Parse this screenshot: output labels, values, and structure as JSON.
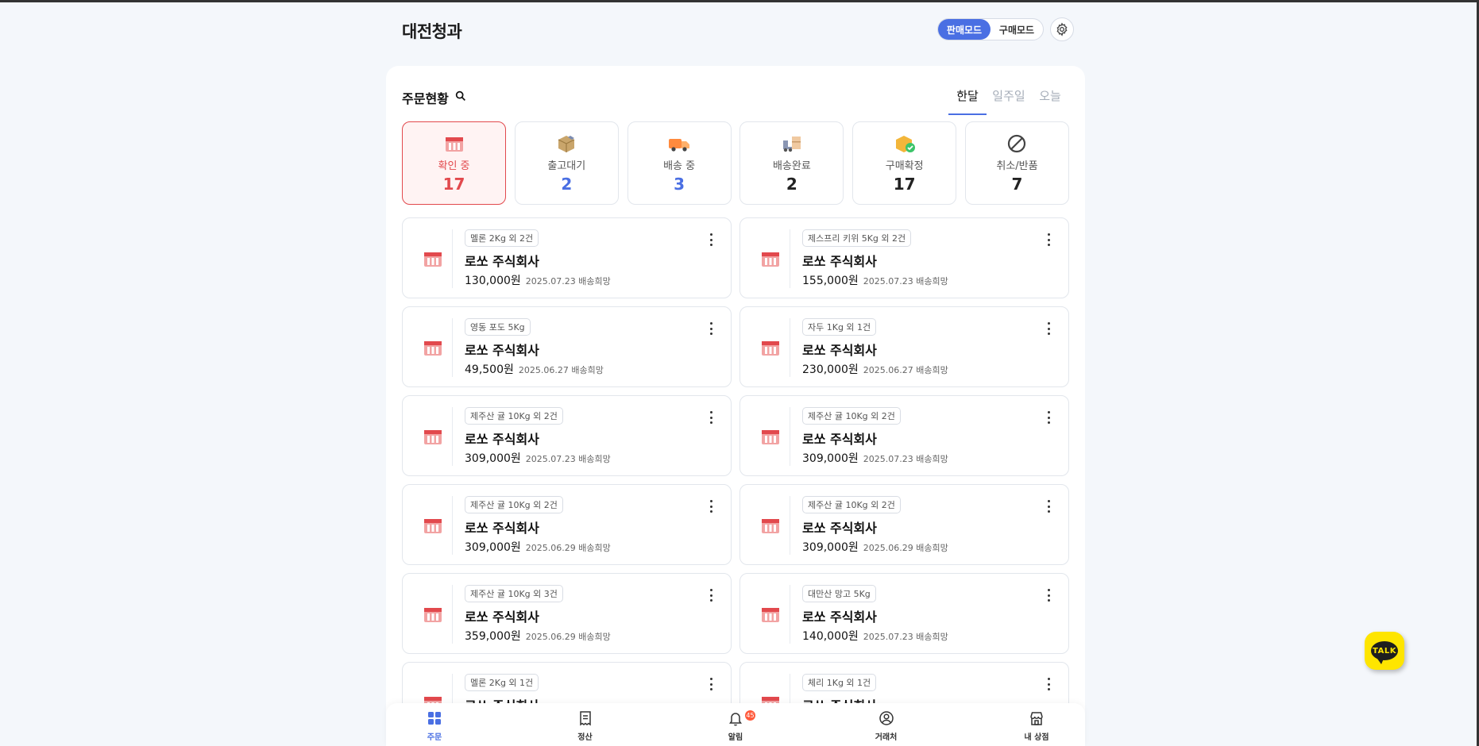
{
  "header": {
    "title": "대전청과",
    "modes": [
      {
        "label": "판매모드",
        "active": true
      },
      {
        "label": "구매모드",
        "active": false
      }
    ],
    "settings_icon": "gear-icon"
  },
  "orders_card": {
    "title": "주문현황",
    "search_icon": "search-icon",
    "periods": [
      {
        "label": "한달",
        "active": true
      },
      {
        "label": "일주일",
        "active": false
      },
      {
        "label": "오늘",
        "active": false
      }
    ],
    "statuses": [
      {
        "label": "확인 중",
        "count": "17",
        "icon": "box-icon",
        "active": true
      },
      {
        "label": "출고대기",
        "count": "2",
        "icon": "package-icon",
        "active": false
      },
      {
        "label": "배송 중",
        "count": "3",
        "icon": "truck-icon",
        "active": false
      },
      {
        "label": "배송완료",
        "count": "2",
        "icon": "delivered-icon",
        "active": false
      },
      {
        "label": "구매확정",
        "count": "17",
        "icon": "confirmed-icon",
        "active": false
      },
      {
        "label": "취소/반품",
        "count": "7",
        "icon": "cancel-icon",
        "active": false
      }
    ],
    "orders": [
      {
        "tag": "멜론 2Kg 외 2건",
        "company": "로쏘 주식회사",
        "price": "130,000원",
        "date": "2025.07.23 배송희망"
      },
      {
        "tag": "제스프리 키위 5Kg 외 2건",
        "company": "로쏘 주식회사",
        "price": "155,000원",
        "date": "2025.07.23 배송희망"
      },
      {
        "tag": "영동 포도 5Kg",
        "company": "로쏘 주식회사",
        "price": "49,500원",
        "date": "2025.06.27 배송희망"
      },
      {
        "tag": "자두 1Kg 외 1건",
        "company": "로쏘 주식회사",
        "price": "230,000원",
        "date": "2025.06.27 배송희망"
      },
      {
        "tag": "제주산 귤 10Kg 외 2건",
        "company": "로쏘 주식회사",
        "price": "309,000원",
        "date": "2025.07.23 배송희망"
      },
      {
        "tag": "제주산 귤 10Kg 외 2건",
        "company": "로쏘 주식회사",
        "price": "309,000원",
        "date": "2025.07.23 배송희망"
      },
      {
        "tag": "제주산 귤 10Kg 외 2건",
        "company": "로쏘 주식회사",
        "price": "309,000원",
        "date": "2025.06.29 배송희망"
      },
      {
        "tag": "제주산 귤 10Kg 외 2건",
        "company": "로쏘 주식회사",
        "price": "309,000원",
        "date": "2025.06.29 배송희망"
      },
      {
        "tag": "제주산 귤 10Kg 외 3건",
        "company": "로쏘 주식회사",
        "price": "359,000원",
        "date": "2025.06.29 배송희망"
      },
      {
        "tag": "대만산 망고 5Kg",
        "company": "로쏘 주식회사",
        "price": "140,000원",
        "date": "2025.07.23 배송희망"
      },
      {
        "tag": "멜론 2Kg 외 1건",
        "company": "로쏘 주식회사",
        "price": "",
        "date": ""
      },
      {
        "tag": "체리 1Kg 외 1건",
        "company": "로쏘 주식회사",
        "price": "",
        "date": ""
      }
    ]
  },
  "bottom_nav": [
    {
      "label": "주문",
      "icon": "grid-icon",
      "active": true,
      "badge": ""
    },
    {
      "label": "정산",
      "icon": "receipt-icon",
      "active": false,
      "badge": ""
    },
    {
      "label": "알림",
      "icon": "bell-icon",
      "active": false,
      "badge": "45"
    },
    {
      "label": "거래처",
      "icon": "user-circle-icon",
      "active": false,
      "badge": ""
    },
    {
      "label": "내 상점",
      "icon": "store-icon",
      "active": false,
      "badge": ""
    }
  ],
  "chat_button": {
    "label": "TALK",
    "color": "#fee500"
  },
  "colors": {
    "accent": "#4a6fe3",
    "alert": "#e2494d",
    "background": "#f4f7fb"
  }
}
